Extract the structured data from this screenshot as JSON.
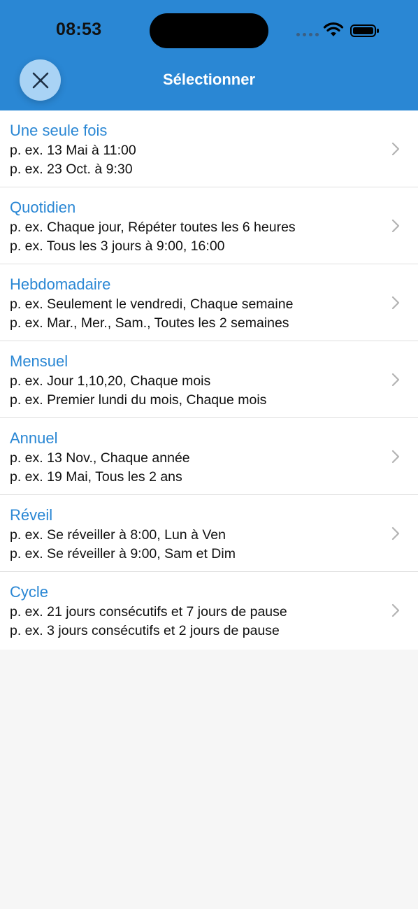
{
  "status_bar": {
    "time": "08:53"
  },
  "header": {
    "title": "Sélectionner",
    "close_icon": "close-icon",
    "background_color": "#2a87d4",
    "close_button_color": "#a9d3f5"
  },
  "options": [
    {
      "title": "Une seule fois",
      "example1": "p. ex. 13 Mai à 11:00",
      "example2": "p. ex. 23 Oct. à 9:30"
    },
    {
      "title": "Quotidien",
      "example1": "p. ex. Chaque jour, Répéter toutes les 6 heures",
      "example2": "p. ex. Tous les 3 jours à 9:00, 16:00"
    },
    {
      "title": "Hebdomadaire",
      "example1": "p. ex. Seulement le vendredi, Chaque semaine",
      "example2": "p. ex. Mar., Mer., Sam., Toutes les 2 semaines"
    },
    {
      "title": "Mensuel",
      "example1": "p. ex. Jour 1,10,20, Chaque mois",
      "example2": "p. ex. Premier lundi du mois, Chaque mois"
    },
    {
      "title": "Annuel",
      "example1": "p. ex. 13 Nov., Chaque année",
      "example2": "p. ex. 19 Mai, Tous les 2 ans"
    },
    {
      "title": "Réveil",
      "example1": "p. ex. Se réveiller à 8:00, Lun à Ven",
      "example2": "p. ex. Se réveiller à 9:00, Sam et Dim"
    },
    {
      "title": "Cycle",
      "example1": "p. ex. 21 jours consécutifs et 7 jours de pause",
      "example2": "p. ex. 3 jours consécutifs et 2 jours de pause"
    }
  ],
  "accent_color": "#2a87d4"
}
